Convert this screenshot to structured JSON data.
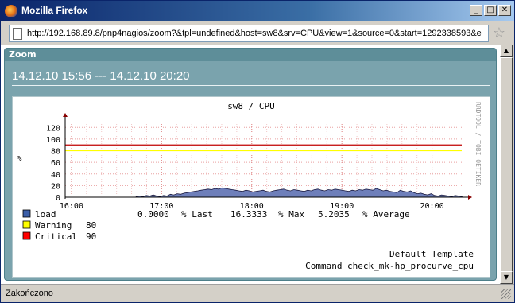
{
  "window": {
    "title": "Mozilla Firefox"
  },
  "url": "http://192.168.89.8/pnp4nagios/zoom?&tpl=undefined&host=sw8&srv=CPU&view=1&source=0&start=1292338593&e",
  "panel": {
    "header": "Zoom",
    "date_range": "14.12.10 15:56 --- 14.12.10 20:20"
  },
  "status": {
    "text": "Zakończono"
  },
  "colors": {
    "load": "#3b5ea8",
    "warning": "#ffff00",
    "critical": "#ff0000",
    "panel": "#7aa3ad"
  },
  "chart_data": {
    "type": "area",
    "title": "sw8 / CPU",
    "ylabel": "%",
    "side_label": "RRDTOOL / TOBI OETIKER",
    "yticks": [
      0,
      20,
      40,
      60,
      80,
      100,
      120
    ],
    "ylim": [
      0,
      130
    ],
    "xticks": [
      "16:00",
      "17:00",
      "18:00",
      "19:00",
      "20:00"
    ],
    "x_hours": [
      15.93,
      20.33
    ],
    "warning": 80,
    "critical": 90,
    "series": [
      {
        "name": "load",
        "x_start": "16:43",
        "x_end": "20:20",
        "values": [
          1,
          2,
          1,
          3,
          2,
          4,
          2,
          1,
          3,
          2,
          5,
          4,
          6,
          5,
          7,
          8,
          9,
          10,
          11,
          12,
          13,
          14,
          13,
          15,
          14,
          16,
          15,
          14,
          13,
          12,
          11,
          10,
          12,
          11,
          9,
          10,
          11,
          12,
          10,
          9,
          11,
          12,
          13,
          14,
          12,
          11,
          13,
          12,
          11,
          10,
          12,
          11,
          13,
          14,
          12,
          11,
          13,
          12,
          14,
          13,
          12,
          11,
          10,
          12,
          11,
          13,
          12,
          14,
          13,
          12,
          15,
          13,
          11,
          12,
          10,
          9,
          8,
          12,
          10,
          9,
          11,
          8,
          6,
          7,
          5,
          4,
          6,
          3,
          2,
          4,
          3,
          2,
          1,
          3,
          2,
          1
        ]
      }
    ],
    "legend": [
      {
        "name": "load",
        "color_key": "load",
        "text": "0.0000  % Last  16.3333  % Max  5.2035  % Average"
      },
      {
        "name": "Warning",
        "color_key": "warning",
        "text": "80"
      },
      {
        "name": "Critical",
        "color_key": "critical",
        "text": "90"
      }
    ],
    "footer": [
      "Default Template",
      "Command check_mk-hp_procurve_cpu"
    ]
  }
}
